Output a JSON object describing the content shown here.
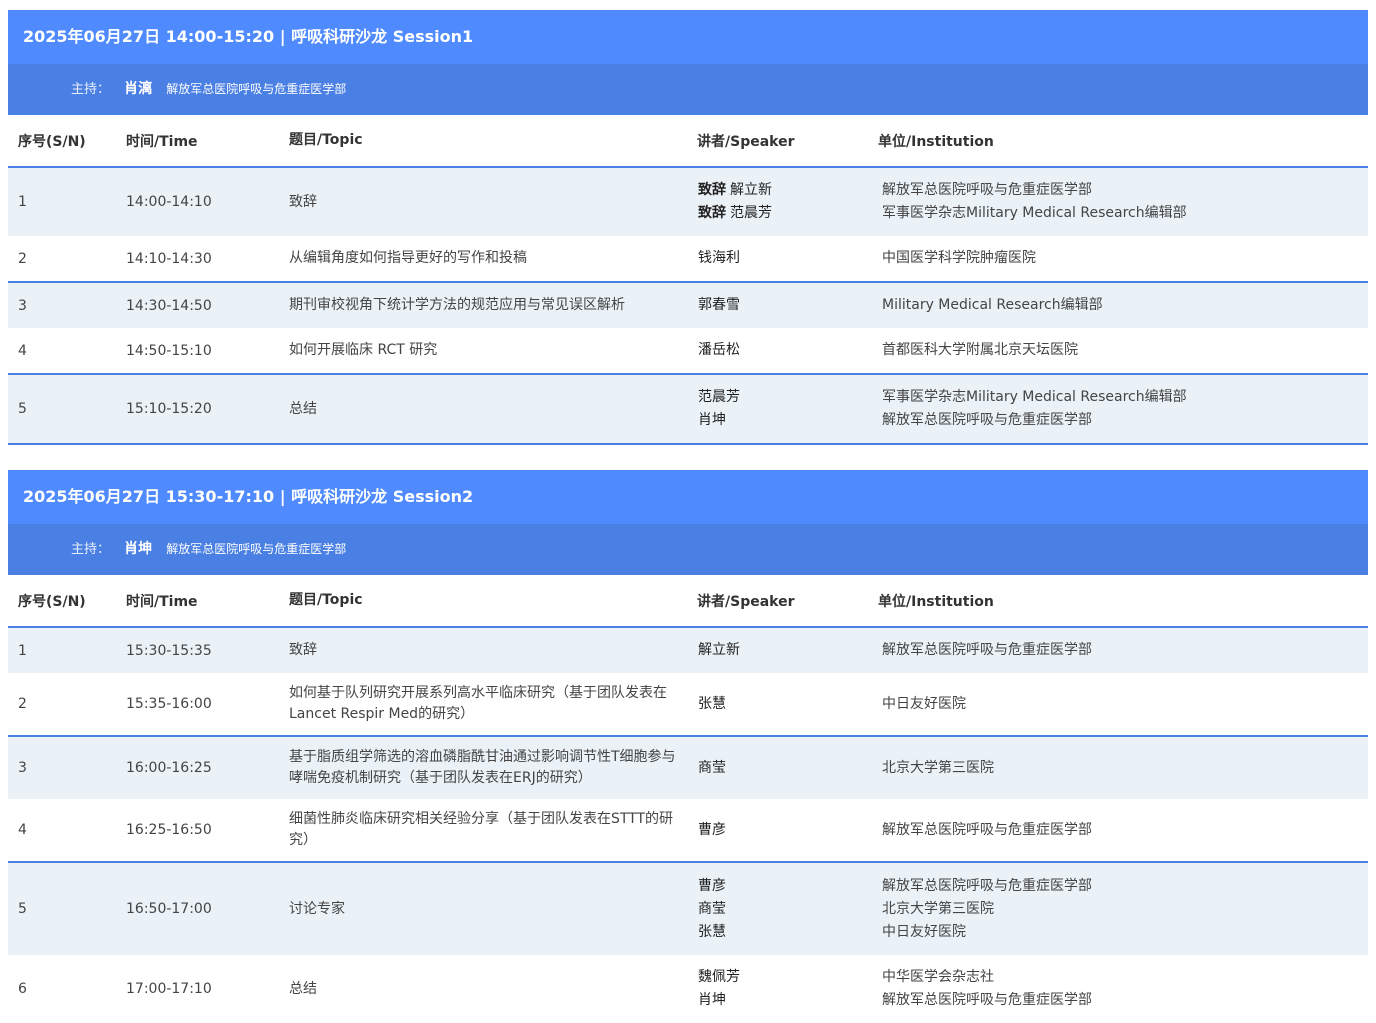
{
  "headers": {
    "sn": "序号(S/N)",
    "time": "时间/Time",
    "topic": "题目/Topic",
    "speaker": "讲者/Speaker",
    "institution": "单位/Institution"
  },
  "sessions": [
    {
      "title": "2025年06月27日 14:00-15:20 | 呼吸科研沙龙 Session1",
      "host_label": "主持：",
      "host_name": "肖漓",
      "host_institution": "解放军总医院呼吸与危重症医学部",
      "rows": [
        {
          "sn": "1",
          "time": "14:00-14:10",
          "topic": "致辞",
          "speakers": [
            {
              "tag": "致辞",
              "name": "解立新"
            },
            {
              "tag": "致辞",
              "name": "范晨芳"
            }
          ],
          "institutions": [
            "解放军总医院呼吸与危重症医学部",
            "军事医学杂志Military Medical Research编辑部"
          ]
        },
        {
          "sn": "2",
          "time": "14:10-14:30",
          "topic": "从编辑角度如何指导更好的写作和投稿",
          "speakers": [
            {
              "tag": "",
              "name": "钱海利"
            }
          ],
          "institutions": [
            "中国医学科学院肿瘤医院"
          ]
        },
        {
          "sn": "3",
          "time": "14:30-14:50",
          "topic": "期刊审校视角下统计学方法的规范应用与常见误区解析",
          "speakers": [
            {
              "tag": "",
              "name": "郭春雪"
            }
          ],
          "institutions": [
            "Military Medical Research编辑部"
          ]
        },
        {
          "sn": "4",
          "time": "14:50-15:10",
          "topic": "如何开展临床 RCT 研究",
          "speakers": [
            {
              "tag": "",
              "name": "潘岳松"
            }
          ],
          "institutions": [
            "首都医科大学附属北京天坛医院"
          ]
        },
        {
          "sn": "5",
          "time": "15:10-15:20",
          "topic": "总结",
          "speakers": [
            {
              "tag": "",
              "name": "范晨芳"
            },
            {
              "tag": "",
              "name": "肖坤"
            }
          ],
          "institutions": [
            "军事医学杂志Military Medical Research编辑部",
            "解放军总医院呼吸与危重症医学部"
          ]
        }
      ]
    },
    {
      "title": "2025年06月27日 15:30-17:10 | 呼吸科研沙龙 Session2",
      "host_label": "主持：",
      "host_name": "肖坤",
      "host_institution": "解放军总医院呼吸与危重症医学部",
      "rows": [
        {
          "sn": "1",
          "time": "15:30-15:35",
          "topic": "致辞",
          "speakers": [
            {
              "tag": "",
              "name": "解立新"
            }
          ],
          "institutions": [
            "解放军总医院呼吸与危重症医学部"
          ]
        },
        {
          "sn": "2",
          "time": "15:35-16:00",
          "topic": "如何基于队列研究开展系列高水平临床研究（基于团队发表在Lancet Respir Med的研究）",
          "speakers": [
            {
              "tag": "",
              "name": "张慧"
            }
          ],
          "institutions": [
            "中日友好医院"
          ]
        },
        {
          "sn": "3",
          "time": "16:00-16:25",
          "topic": "基于脂质组学筛选的溶血磷脂酰甘油通过影响调节性T细胞参与哮喘免疫机制研究（基于团队发表在ERJ的研究）",
          "speakers": [
            {
              "tag": "",
              "name": "商莹"
            }
          ],
          "institutions": [
            "北京大学第三医院"
          ]
        },
        {
          "sn": "4",
          "time": "16:25-16:50",
          "topic": "细菌性肺炎临床研究相关经验分享（基于团队发表在STTT的研究）",
          "speakers": [
            {
              "tag": "",
              "name": "曹彦"
            }
          ],
          "institutions": [
            "解放军总医院呼吸与危重症医学部"
          ]
        },
        {
          "sn": "5",
          "time": "16:50-17:00",
          "topic": "讨论专家",
          "speakers": [
            {
              "tag": "",
              "name": "曹彦"
            },
            {
              "tag": "",
              "name": "商莹"
            },
            {
              "tag": "",
              "name": "张慧"
            }
          ],
          "institutions": [
            "解放军总医院呼吸与危重症医学部",
            "北京大学第三医院",
            "中日友好医院"
          ]
        },
        {
          "sn": "6",
          "time": "17:00-17:10",
          "topic": "总结",
          "speakers": [
            {
              "tag": "",
              "name": "魏佩芳"
            },
            {
              "tag": "",
              "name": "肖坤"
            }
          ],
          "institutions": [
            "中华医学会杂志社",
            "解放军总医院呼吸与危重症医学部"
          ]
        }
      ]
    }
  ]
}
